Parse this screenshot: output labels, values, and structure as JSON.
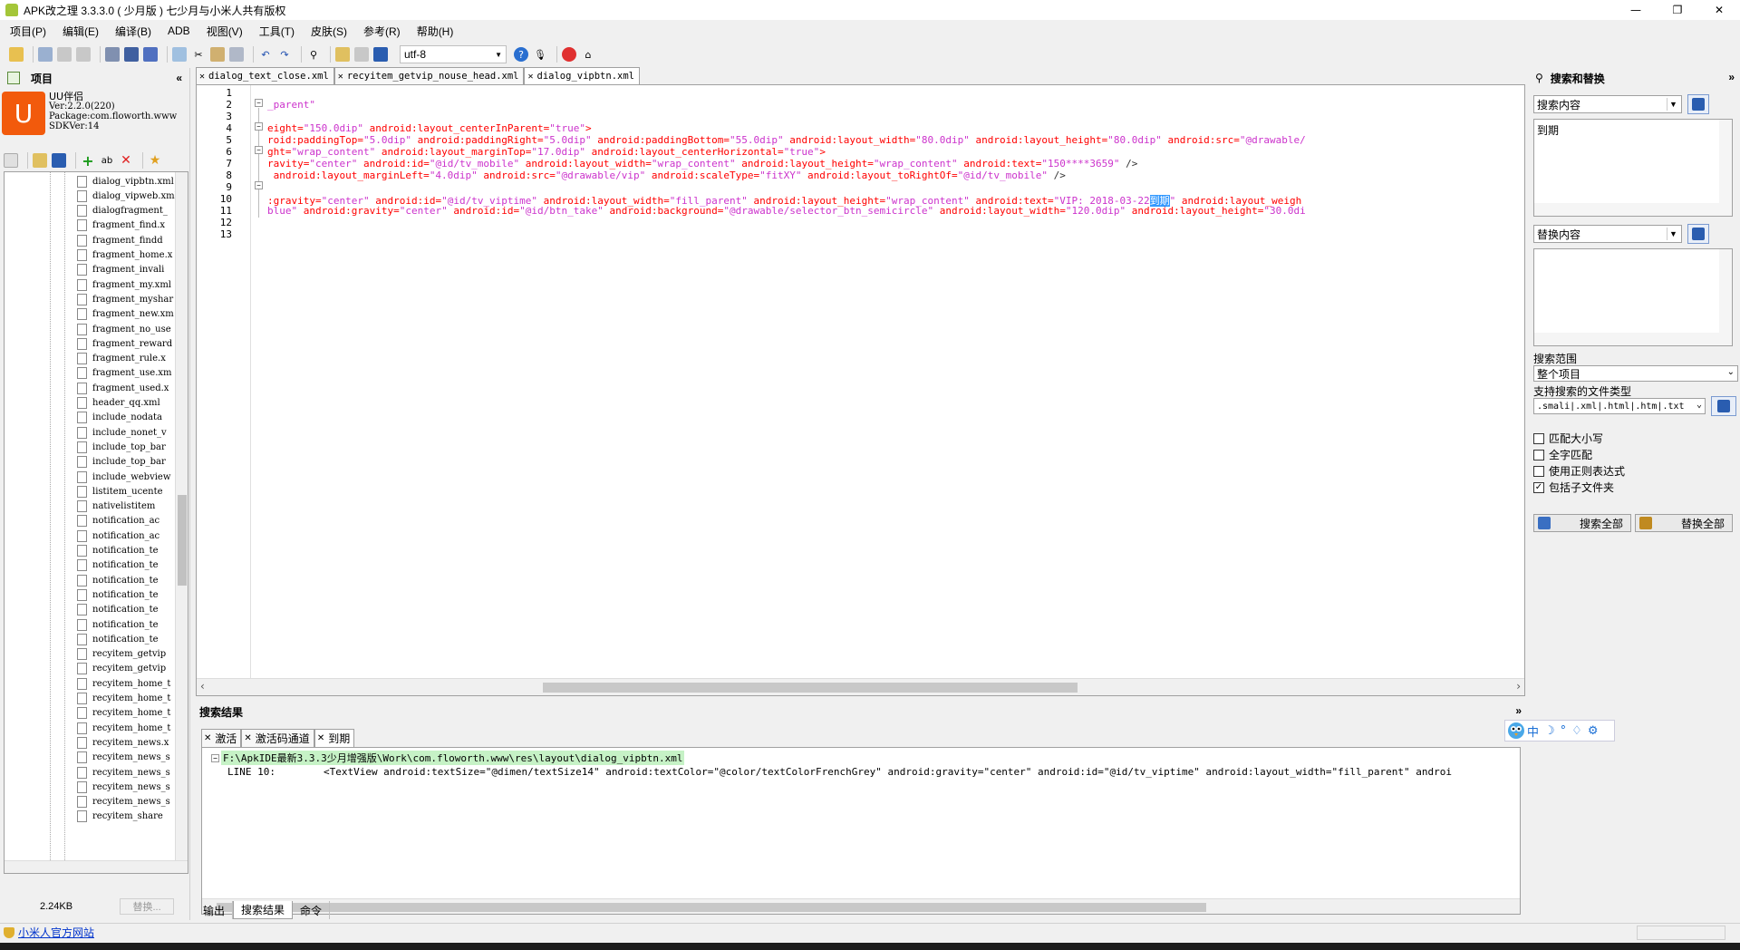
{
  "window": {
    "title": "APK改之理 3.3.3.0 ( 少月版 )  七少月与小米人共有版权",
    "controls": [
      "—",
      "❐",
      "✕"
    ]
  },
  "menu": [
    "项目(P)",
    "编辑(E)",
    "编译(B)",
    "ADB",
    "视图(V)",
    "工具(T)",
    "皮肤(S)",
    "参考(R)",
    "帮助(H)"
  ],
  "toolbar": {
    "encoding": "utf-8"
  },
  "project": {
    "header": "项目",
    "collapse": "«",
    "app_name": "UU伴侣",
    "version": "Ver:2.2.0(220)",
    "package": "Package:com.floworth.www",
    "sdk": "SDKVer:14",
    "files": [
      "dialog_vipbtn.xml",
      "dialog_vipweb.xml",
      "dialogfragment_",
      "fragment_find.x",
      "fragment_findd",
      "fragment_home.x",
      "fragment_invali",
      "fragment_my.xml",
      "fragment_myshar",
      "fragment_new.xm",
      "fragment_no_use",
      "fragment_reward",
      "fragment_rule.x",
      "fragment_use.xm",
      "fragment_used.x",
      "header_qq.xml",
      "include_nodata",
      "include_nonet_v",
      "include_top_bar",
      "include_top_bar",
      "include_webview",
      "listitem_ucente",
      "nativelistitem",
      "notification_ac",
      "notification_ac",
      "notification_te",
      "notification_te",
      "notification_te",
      "notification_te",
      "notification_te",
      "notification_te",
      "notification_te",
      "recyitem_getvip",
      "recyitem_getvip",
      "recyitem_home_t",
      "recyitem_home_t",
      "recyitem_home_t",
      "recyitem_home_t",
      "recyitem_news.x",
      "recyitem_news_s",
      "recyitem_news_s",
      "recyitem_news_s",
      "recyitem_news_s",
      "recyitem_share"
    ],
    "file_size": "2.24KB",
    "replace_button": "替换..."
  },
  "editor": {
    "tabs": [
      "dialog_text_close.xml",
      "recyitem_getvip_nouse_head.xml",
      "dialog_vipbtn.xml"
    ],
    "active_tab": 2,
    "line_numbers": [
      "1",
      "2",
      "3",
      "4",
      "5",
      "6",
      "7",
      "8",
      "9",
      "10",
      "11",
      "12",
      "13"
    ],
    "lines": [
      [],
      [
        {
          "t": "_parent\"",
          "c": "av"
        }
      ],
      [],
      [
        {
          "t": "eight=",
          "c": "at"
        },
        {
          "t": "\"150.0dip\"",
          "c": "av"
        },
        {
          "t": " android:layout_centerInParent=",
          "c": "at"
        },
        {
          "t": "\"true\"",
          "c": "av"
        },
        {
          "t": ">",
          "c": "at"
        }
      ],
      [
        {
          "t": "roid:paddingTop=",
          "c": "at"
        },
        {
          "t": "\"5.0dip\"",
          "c": "av"
        },
        {
          "t": " android:paddingRight=",
          "c": "at"
        },
        {
          "t": "\"5.0dip\"",
          "c": "av"
        },
        {
          "t": " android:paddingBottom=",
          "c": "at"
        },
        {
          "t": "\"55.0dip\"",
          "c": "av"
        },
        {
          "t": " android:layout_width=",
          "c": "at"
        },
        {
          "t": "\"80.0dip\"",
          "c": "av"
        },
        {
          "t": " android:layout_height=",
          "c": "at"
        },
        {
          "t": "\"80.0dip\"",
          "c": "av"
        },
        {
          "t": " android:src=",
          "c": "at"
        },
        {
          "t": "\"@drawable/",
          "c": "av"
        }
      ],
      [
        {
          "t": "ght=",
          "c": "at"
        },
        {
          "t": "\"wrap_content\"",
          "c": "av"
        },
        {
          "t": " android:layout_marginTop=",
          "c": "at"
        },
        {
          "t": "\"17.0dip\"",
          "c": "av"
        },
        {
          "t": " android:layout_centerHorizontal=",
          "c": "at"
        },
        {
          "t": "\"true\"",
          "c": "av"
        },
        {
          "t": ">",
          "c": "at"
        }
      ],
      [
        {
          "t": "ravity=",
          "c": "at"
        },
        {
          "t": "\"center\"",
          "c": "av"
        },
        {
          "t": " android:id=",
          "c": "at"
        },
        {
          "t": "\"@id/tv_mobile\"",
          "c": "av"
        },
        {
          "t": " android:layout_width=",
          "c": "at"
        },
        {
          "t": "\"wrap_content\"",
          "c": "av"
        },
        {
          "t": " android:layout_height=",
          "c": "at"
        },
        {
          "t": "\"wrap_content\"",
          "c": "av"
        },
        {
          "t": " android:text=",
          "c": "at"
        },
        {
          "t": "\"150****3659\"",
          "c": "av"
        },
        {
          "t": " />",
          "c": "ct"
        }
      ],
      [
        {
          "t": " android:layout_marginLeft=",
          "c": "at"
        },
        {
          "t": "\"4.0dip\"",
          "c": "av"
        },
        {
          "t": " android:src=",
          "c": "at"
        },
        {
          "t": "\"@drawable/vip\"",
          "c": "av"
        },
        {
          "t": " android:scaleType=",
          "c": "at"
        },
        {
          "t": "\"fitXY\"",
          "c": "av"
        },
        {
          "t": " android:layout_toRightOf=",
          "c": "at"
        },
        {
          "t": "\"@id/tv_mobile\"",
          "c": "av"
        },
        {
          "t": " />",
          "c": "ct"
        }
      ],
      [],
      [
        {
          "t": ":gravity=",
          "c": "at"
        },
        {
          "t": "\"center\"",
          "c": "av"
        },
        {
          "t": " android:id=",
          "c": "at"
        },
        {
          "t": "\"@id/tv_viptime\"",
          "c": "av"
        },
        {
          "t": " android:layout_width=",
          "c": "at"
        },
        {
          "t": "\"fill_parent\"",
          "c": "av"
        },
        {
          "t": " android:layout_height=",
          "c": "at"
        },
        {
          "t": "\"wrap_content\"",
          "c": "av"
        },
        {
          "t": " android:text=",
          "c": "at"
        },
        {
          "t": "\"VIP: 2018-03-22",
          "c": "av"
        },
        {
          "t": "到期",
          "c": "hl"
        },
        {
          "t": "\"",
          "c": "av"
        },
        {
          "t": " android:layout_weigh",
          "c": "at"
        }
      ],
      [
        {
          "t": "blue\"",
          "c": "av"
        },
        {
          "t": " android:gravity=",
          "c": "at"
        },
        {
          "t": "\"center\"",
          "c": "av"
        },
        {
          "t": " android:id=",
          "c": "at"
        },
        {
          "t": "\"@id/btn_take\"",
          "c": "av"
        },
        {
          "t": " android:background=",
          "c": "at"
        },
        {
          "t": "\"@drawable/selector_btn_semicircle\"",
          "c": "av"
        },
        {
          "t": " android:layout_width=",
          "c": "at"
        },
        {
          "t": "\"120.0dip\"",
          "c": "av"
        },
        {
          "t": " android:layout_height=",
          "c": "at"
        },
        {
          "t": "\"30.0di",
          "c": "av"
        }
      ],
      [],
      []
    ]
  },
  "results": {
    "header": "搜索结果",
    "collapse": "»",
    "tabs": [
      "激活",
      "激活码通道",
      "到期"
    ],
    "active_tab": 2,
    "file_path": "F:\\ApkIDE最新3.3.3少月增强版\\Work\\com.floworth.www\\res\\layout\\dialog_vipbtn.xml",
    "match_line": "LINE 10:        <TextView android:textSize=\"@dimen/textSize14\" android:textColor=\"@color/textColorFrenchGrey\" android:gravity=\"center\" android:id=\"@id/tv_viptime\" android:layout_width=\"fill_parent\" androi"
  },
  "bottom_tabs": [
    "输出",
    "搜索结果",
    "命令"
  ],
  "bottom_active": 1,
  "search_panel": {
    "header": "搜索和替换",
    "collapse": "»",
    "search_label": "搜索内容",
    "search_text": "到期",
    "replace_label": "替换内容",
    "replace_text": "",
    "scope_label": "搜索范围",
    "scope_value": "整个项目",
    "filetypes_label": "支持搜索的文件类型",
    "filetypes_value": ".smali|.xml|.html|.htm|.txt",
    "options": [
      {
        "label": "匹配大小写",
        "checked": false
      },
      {
        "label": "全字匹配",
        "checked": false
      },
      {
        "label": "使用正则表达式",
        "checked": false
      },
      {
        "label": "包括子文件夹",
        "checked": true
      }
    ],
    "search_all": "搜索全部",
    "replace_all": "替换全部"
  },
  "ime": [
    "中",
    "☽",
    "°",
    "♢",
    "⚙"
  ],
  "status": {
    "link": "小米人官方网站"
  },
  "colors": {
    "attr": "#ff0000",
    "value": "#cc33cc",
    "highlight": "#3399ff",
    "logo": "#f25a0c",
    "path_bg": "#c6f2c6"
  }
}
